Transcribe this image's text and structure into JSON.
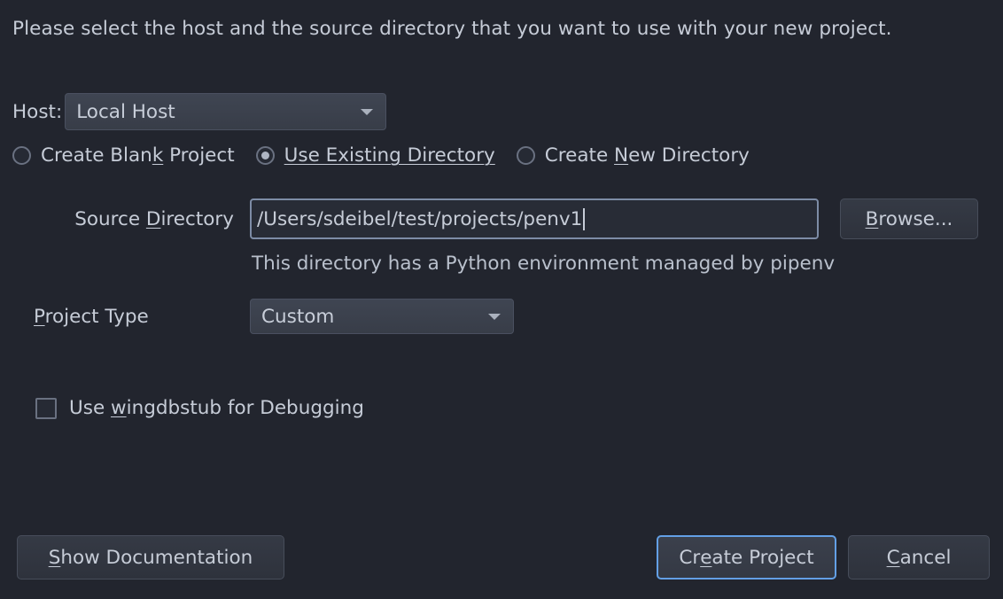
{
  "dialog": {
    "intro": "Please select the host and the source directory that you want to use with your new project.",
    "colors": {
      "background": "#22252e",
      "text": "#c6ccd7",
      "focus_border": "#63a0e6",
      "input_border": "#7d8ca6",
      "control_fill": "#3f4552"
    }
  },
  "host": {
    "label": "Host:",
    "value": "Local Host",
    "arrow_icon": "chevron-down-icon"
  },
  "mode": {
    "options": [
      {
        "label": "Create Blank Project",
        "mnemonic": "k",
        "selected": false,
        "focused": false
      },
      {
        "label": "Use Existing Directory",
        "mnemonic": "U",
        "selected": true,
        "focused": true
      },
      {
        "label": "Create New Directory",
        "mnemonic": "N",
        "selected": false,
        "focused": false
      }
    ]
  },
  "source_directory": {
    "label_pre": "Source ",
    "label_mnemonic": "D",
    "label_post": "irectory",
    "value": "/Users/sdeibel/test/projects/penv1",
    "placeholder": "",
    "browse_pre": "",
    "browse_mnemonic": "B",
    "browse_post": "rowse...",
    "helper_text": "This directory has a Python environment managed by pipenv"
  },
  "project_type": {
    "label_mnemonic": "P",
    "label_post": "roject Type",
    "value": "Custom",
    "arrow_icon": "chevron-down-icon"
  },
  "wingdbstub": {
    "pre": "Use ",
    "mnemonic": "w",
    "post": "ingdbstub for Debugging",
    "checked": false
  },
  "footer": {
    "show_documentation": {
      "mnemonic": "S",
      "post": "how Documentation"
    },
    "create_project": {
      "pre": "Cr",
      "mnemonic": "e",
      "post": "ate Project",
      "is_default": true
    },
    "cancel": {
      "mnemonic": "C",
      "post": "ancel"
    }
  }
}
